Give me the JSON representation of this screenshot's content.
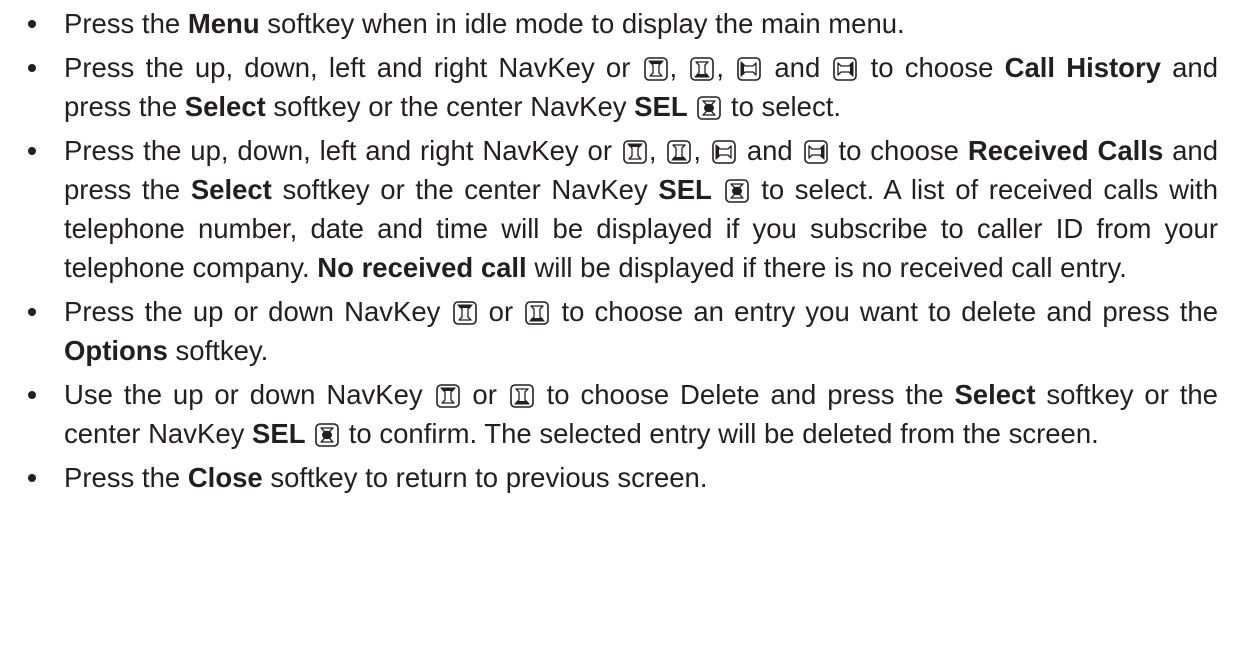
{
  "items": [
    {
      "t1": "Press the ",
      "b1": "Menu",
      "t2": " softkey when in idle mode to display the main menu."
    },
    {
      "t1": "Press the up, down, left and right NavKey or ",
      "s1": ", ",
      "s2": ", ",
      "s3": " and ",
      "t2": " to choose ",
      "b1": "Call History",
      "t3": " and press the ",
      "b2": "Select",
      "t4": " softkey or the center NavKey ",
      "b3": "SEL",
      "t5": " to select."
    },
    {
      "t1": "Press the up, down, left and right NavKey or ",
      "s1": ", ",
      "s2": ", ",
      "s3": " and ",
      "t2": " to choose ",
      "b1": "Received Calls",
      "t3": " and press the ",
      "b2": "Select",
      "t4": " softkey or the center NavKey ",
      "b3": "SEL",
      "t5": " to select. A list of received calls with telephone number, date and time will be displayed if you subscribe to caller ID from your telephone company. ",
      "b4": "No received call",
      "t6": " will be displayed if there is no received call entry."
    },
    {
      "t1": "Press the up or down NavKey ",
      "s1": " or ",
      "t2": " to choose an entry you want to delete and press the ",
      "b1": "Options",
      "t3": " softkey."
    },
    {
      "t1": "Use the up or down NavKey ",
      "s1": " or ",
      "t2": " to choose Delete and press the ",
      "b1": "Select",
      "t3": " softkey or the center NavKey ",
      "b2": "SEL",
      "t4": " to confirm. The selected entry will be deleted from the screen."
    },
    {
      "t1": "Press the ",
      "b1": "Close",
      "t2": " softkey to return to previous screen."
    }
  ],
  "icons": {
    "up": "navkey-up-icon",
    "down": "navkey-down-icon",
    "left": "navkey-left-icon",
    "right": "navkey-right-icon",
    "center": "navkey-center-icon"
  }
}
